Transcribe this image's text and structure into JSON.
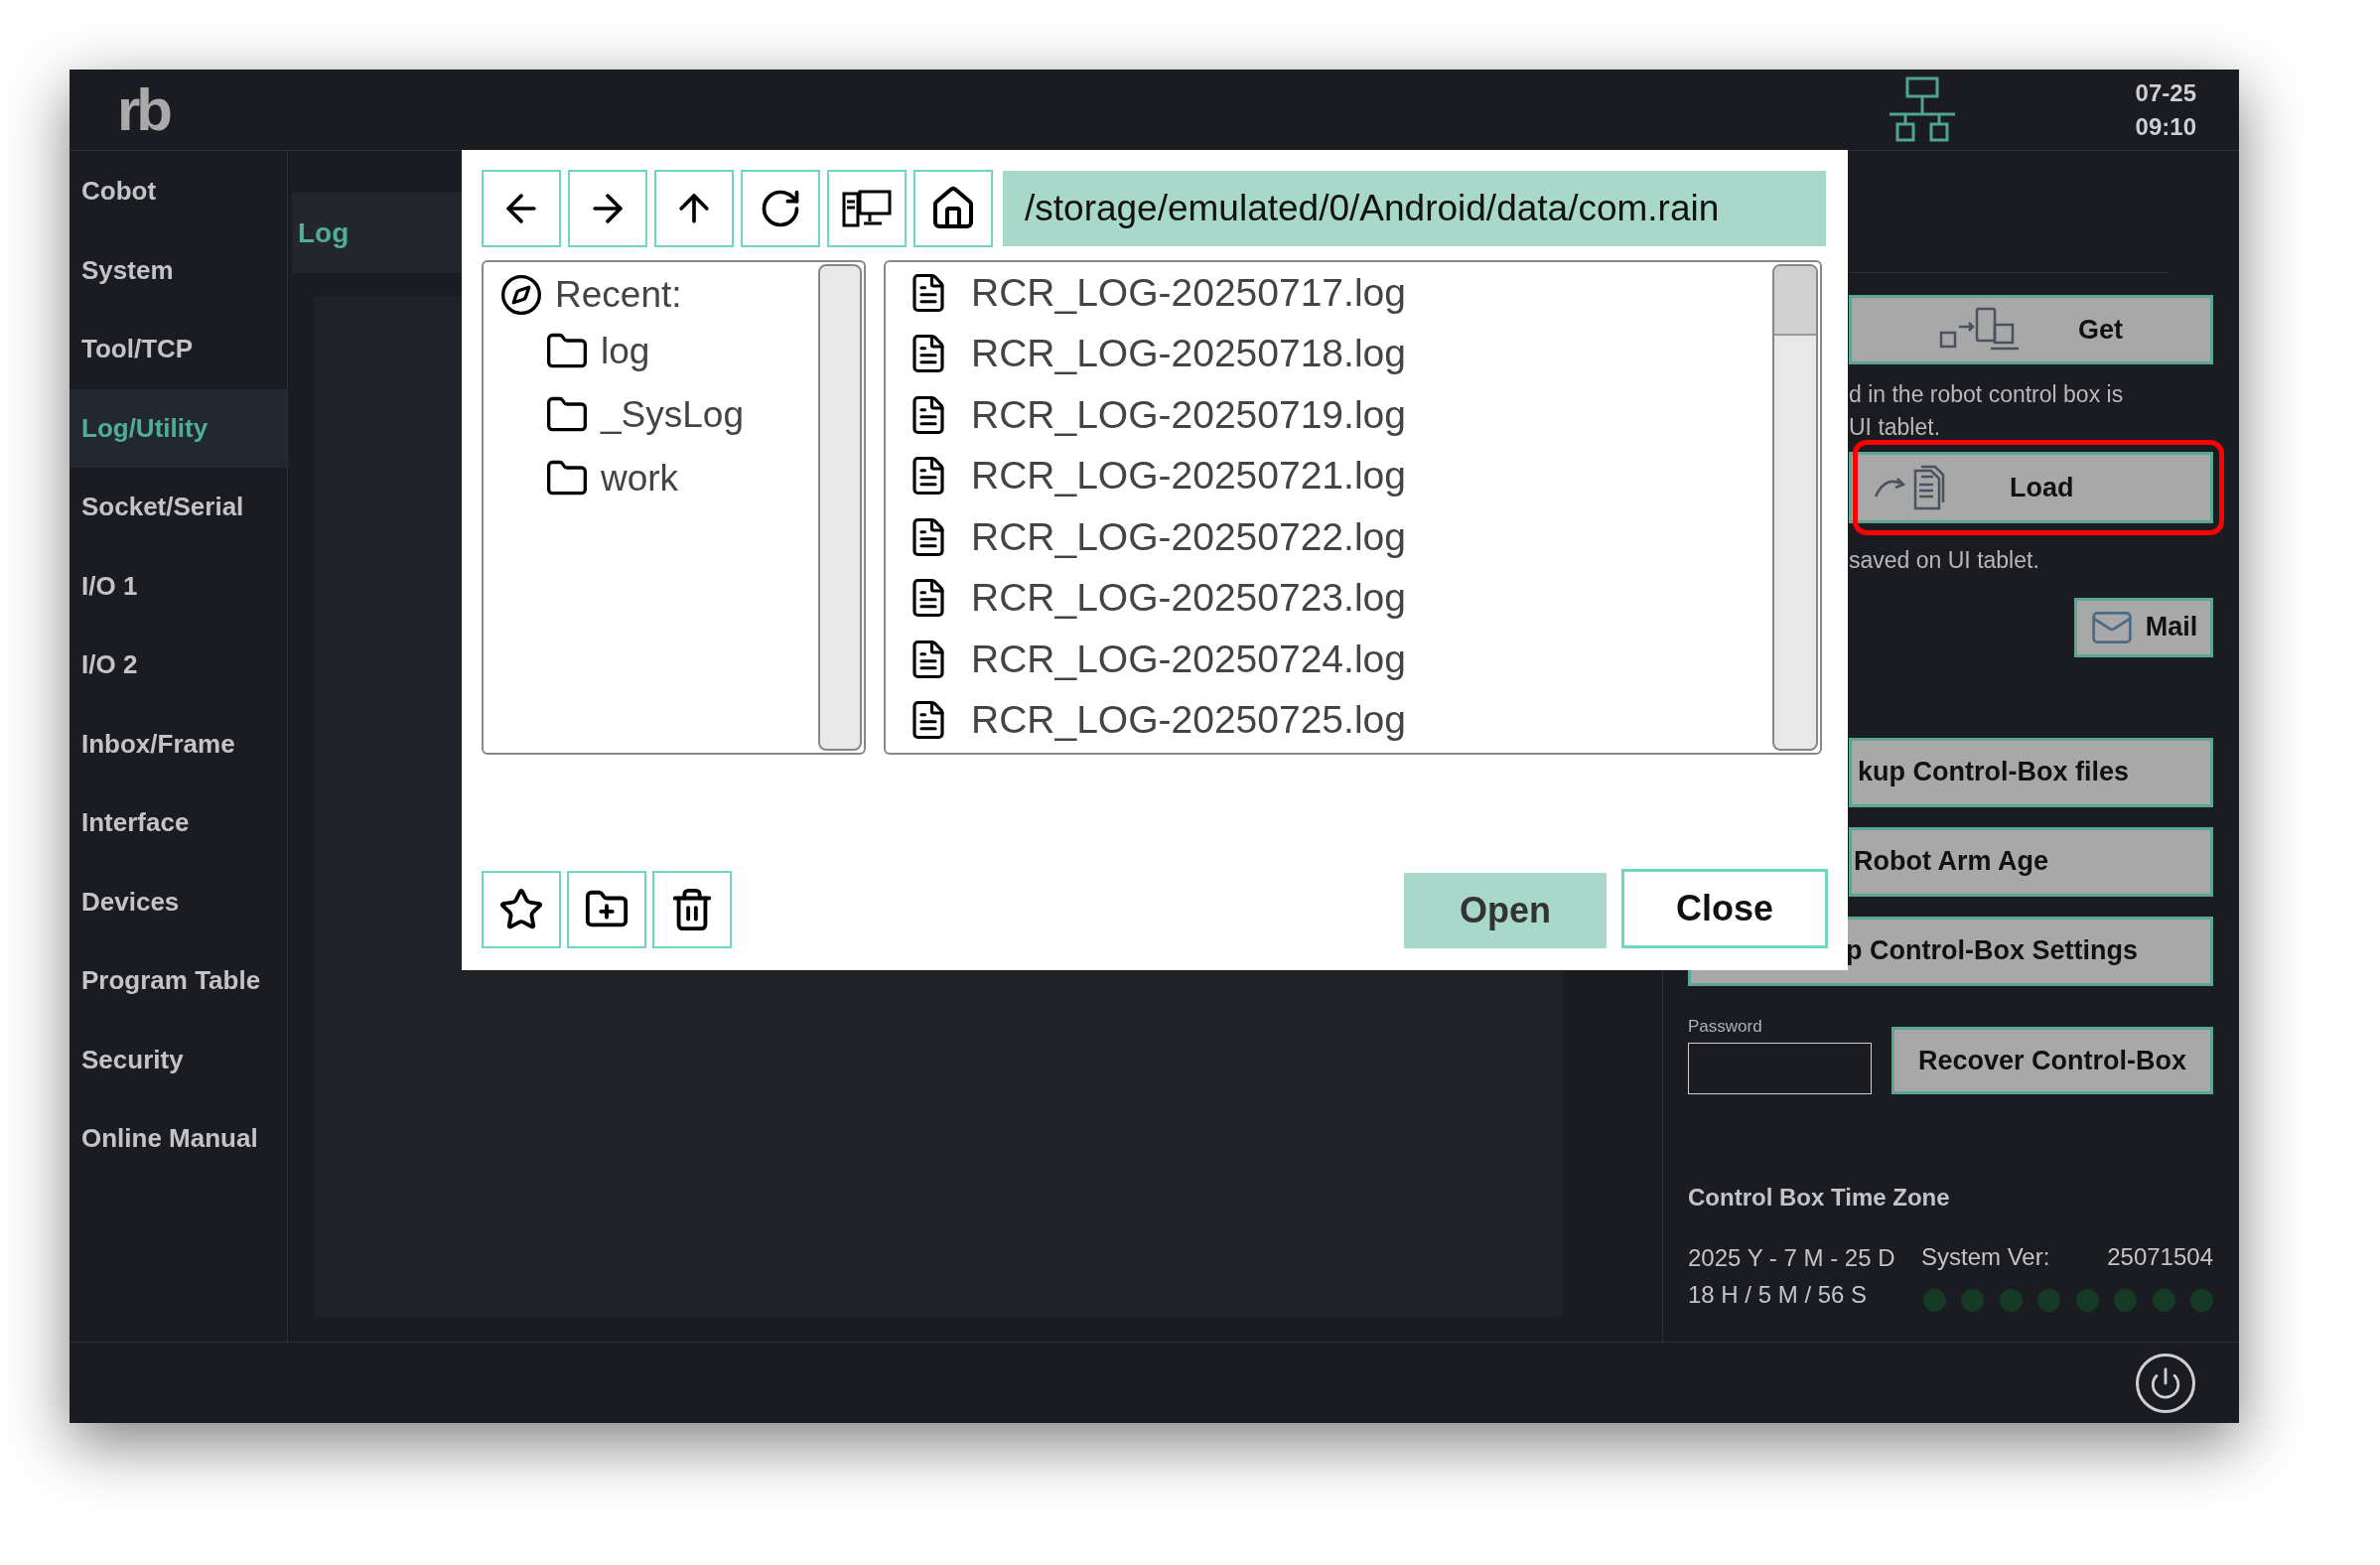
{
  "header": {
    "logo": "rb",
    "date": "07-25",
    "time": "09:10"
  },
  "sidebar": {
    "items": [
      {
        "label": "Cobot",
        "selected": false
      },
      {
        "label": "System",
        "selected": false
      },
      {
        "label": "Tool/TCP",
        "selected": false
      },
      {
        "label": "Log/Utility",
        "selected": true
      },
      {
        "label": "Socket/Serial",
        "selected": false
      },
      {
        "label": "I/O 1",
        "selected": false
      },
      {
        "label": "I/O 2",
        "selected": false
      },
      {
        "label": "Inbox/Frame",
        "selected": false
      },
      {
        "label": "Interface",
        "selected": false
      },
      {
        "label": "Devices",
        "selected": false
      },
      {
        "label": "Program Table",
        "selected": false
      },
      {
        "label": "Security",
        "selected": false
      },
      {
        "label": "Online Manual",
        "selected": false
      }
    ]
  },
  "tabs": [
    {
      "label": "Log",
      "selected": true
    }
  ],
  "right_panel": {
    "get_button": "Get",
    "get_note": [
      "d in the robot control box is",
      "UI tablet."
    ],
    "load_button": "Load",
    "load_highlighted": true,
    "load_note": "saved on UI tablet.",
    "mail_button": "Mail",
    "backup_files_button": "kup Control-Box files",
    "robot_arm_age_button": "Robot Arm Age",
    "backup_settings_button": "p Control-Box Settings",
    "password_label": "Password",
    "recover_button": "Recover Control-Box",
    "time_zone_title": "Control Box Time Zone",
    "date_line": "2025 Y - 7 M - 25 D",
    "time_line": "18 H / 5 M / 56 S",
    "system_ver_label": "System Ver:",
    "system_ver": "25071504",
    "status_lights": [
      {
        "on": false
      },
      {
        "on": false
      },
      {
        "on": false
      },
      {
        "on": false
      },
      {
        "on": false
      },
      {
        "on": false
      },
      {
        "on": false
      },
      {
        "on": false
      }
    ]
  },
  "file_dialog": {
    "path": "/storage/emulated/0/Android/data/com.rain",
    "recent_label": "Recent:",
    "recent_folders": [
      "log",
      "_SysLog",
      "work"
    ],
    "files": [
      {
        "name": "RCR_LOG-20250717.log",
        "selected": false
      },
      {
        "name": "RCR_LOG-20250718.log",
        "selected": false
      },
      {
        "name": "RCR_LOG-20250719.log",
        "selected": false
      },
      {
        "name": "RCR_LOG-20250721.log",
        "selected": false
      },
      {
        "name": "RCR_LOG-20250722.log",
        "selected": false
      },
      {
        "name": "RCR_LOG-20250723.log",
        "selected": false
      },
      {
        "name": "RCR_LOG-20250724.log",
        "selected": false
      },
      {
        "name": "RCR_LOG-20250725.log",
        "selected": false
      }
    ],
    "open_button": "Open",
    "close_button": "Close"
  }
}
